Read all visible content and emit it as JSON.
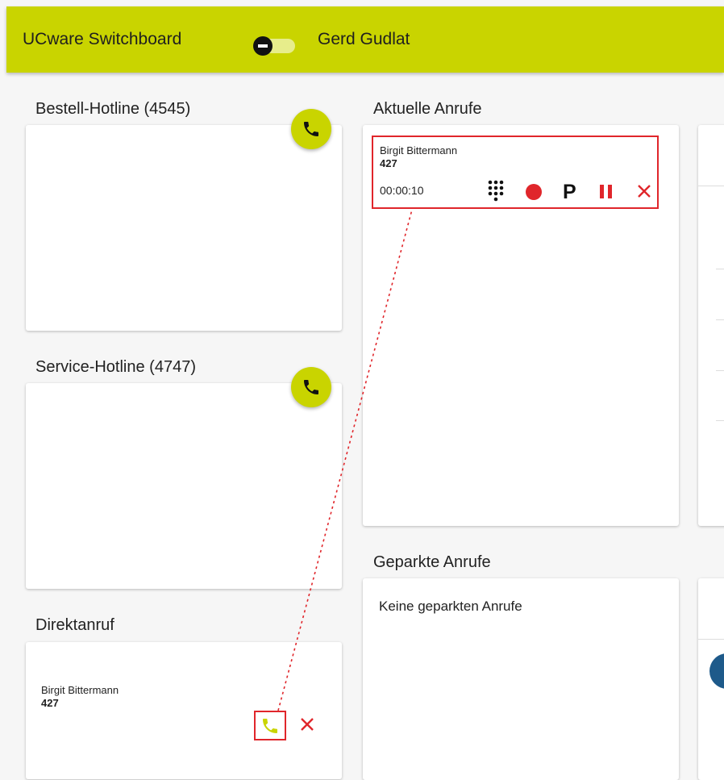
{
  "app": {
    "title": "UCware Switchboard",
    "user_name": "Gerd Gudlat",
    "toggle_on": false
  },
  "queues": [
    {
      "title": "Bestell-Hotline (4545)"
    },
    {
      "title": "Service-Hotline (4747)"
    }
  ],
  "direct": {
    "title": "Direktanruf",
    "caller_name": "Birgit Bittermann",
    "caller_number": "427"
  },
  "current_calls": {
    "title": "Aktuelle Anrufe",
    "call": {
      "caller_name": "Birgit Bittermann",
      "caller_number": "427",
      "duration": "00:00:10",
      "park_label": "P"
    }
  },
  "parked_calls": {
    "title": "Geparkte Anrufe",
    "empty_message": "Keine geparkten Anrufe"
  },
  "colors": {
    "accent": "#c9d400",
    "danger": "#e0262b",
    "connector": "#e0262b"
  }
}
